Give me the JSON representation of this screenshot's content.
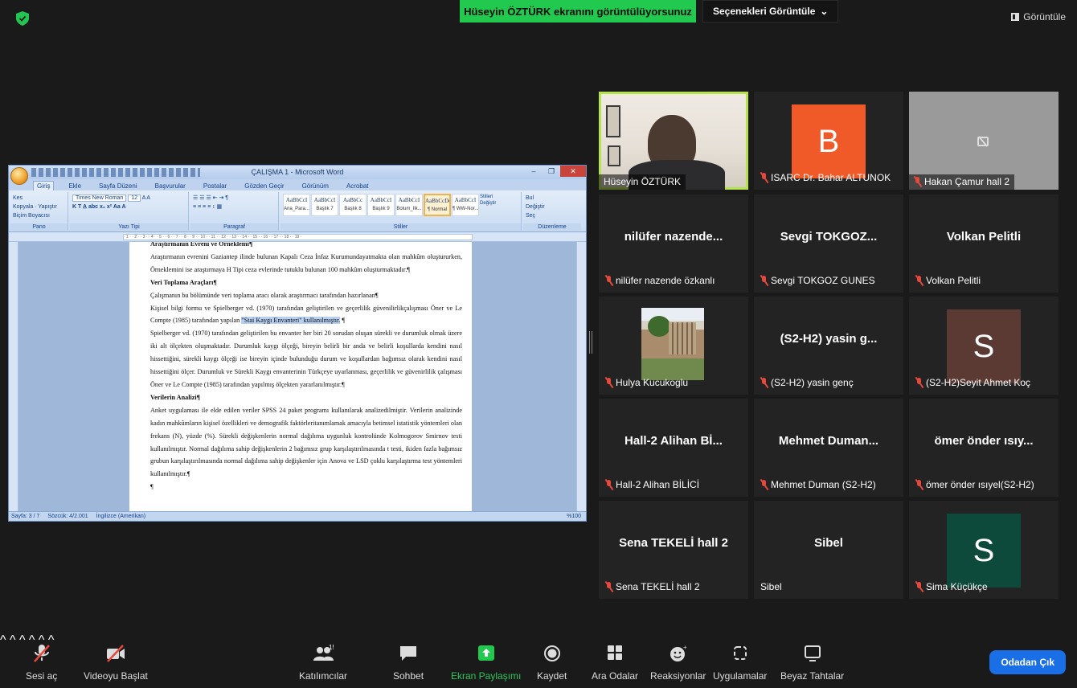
{
  "top": {
    "banner": "Hüseyin  ÖZTÜRK ekranını görüntülüyorsunuz",
    "view_options": "Seçenekleri Görüntüle",
    "view_button": "Görüntüle"
  },
  "word": {
    "title": "ÇALIŞMA 1 - Microsoft Word",
    "tabs": [
      "Giriş",
      "Ekle",
      "Sayfa Düzeni",
      "Başvurular",
      "Postalar",
      "Gözden Geçir",
      "Görünüm",
      "Acrobat"
    ],
    "ribbon": {
      "clipboard": {
        "label": "Pano",
        "cut": "Kes",
        "copy": "Kopyala",
        "paste": "Yapıştır",
        "format_painter": "Biçim Boyacısı"
      },
      "font": {
        "label": "Yazı Tipi",
        "name": "Times New Roman",
        "size": "12"
      },
      "paragraph": {
        "label": "Paragraf"
      },
      "styles": {
        "label": "Stiller",
        "items": [
          {
            "preview": "AaBbCcI",
            "name": "Ana_Para..."
          },
          {
            "preview": "AaBbCcI",
            "name": "Başlık 7"
          },
          {
            "preview": "AaBbCc",
            "name": "Başlık 8"
          },
          {
            "preview": "AaBbCcI",
            "name": "Başlık 9"
          },
          {
            "preview": "AaBbCcI",
            "name": "Bolum_Ilk..."
          },
          {
            "preview": "AaBbCcDc",
            "name": "¶ Normal"
          },
          {
            "preview": "AaBbCcI",
            "name": "¶ WW-Nor..."
          }
        ],
        "change": "Stilleri Değiştir"
      },
      "editing": {
        "label": "Düzenleme",
        "find": "Bul",
        "replace": "Değiştir",
        "select": "Seç"
      }
    },
    "doc": {
      "h0": "Araştırmanın Evreni ve Örneklemi¶",
      "p1": "Araştırmanın evrenini Gaziantep ilinde bulunan Kapalı Ceza İnfaz Kurumundayatmakta olan mahkûm oluştururken, Örneklemini ise araştırmaya H Tipi ceza evlerinde tutuklu bulunan 100 mahkûm oluşturmaktadır.¶",
      "h1": "Veri Toplama Araçları¶",
      "p2": "Çalışmanın bu bölümünde veri toplama aracı olarak araştırmacı tarafından hazırlanan¶",
      "p3a": "Kişisel bilgi formu ve Spielberger vd. (1970) tarafından geliştirilen ve geçerlilik güvenilirlikçalışması Öner ve Le Compte (1985) tarafından yapılan ",
      "p3b": "\"Stai Kaygı Envanteri\" kullanılmıştır.",
      "p3c": " ¶",
      "p4": "Spielberger vd. (1970) tarafından geliştirilen bu envanter her biri 20 sorudan oluşan sürekli ve durumluk olmak üzere iki alt ölçekten oluşmaktadır. Durumluk kaygı ölçeği, bireyin belirli bir anda ve belirli koşullarda kendini nasıl hissettiğini, sürekli kaygı ölçeği ise bireyin içinde bulunduğu durum ve koşullardan bağımsız olarak kendini nasıl hissettiğini ölçer. Durumluk ve Sürekli Kaygı envanterinin Türkçeye uyarlanması, geçerlilik ve güvenirlilik çalışması Öner ve Le Compte (1985) tarafından yapılmış ölçekten yararlanılmıştır.¶",
      "h2": "Verilerin Analizi¶",
      "p5": "Anket uygulaması ile elde edilen veriler SPSS 24 paket programı kullanılarak analizedilmiştir. Verilerin analizinde kadın mahkûmların kişisel özellikleri ve demografik faktörleritanımlamak amacıyla betimsel istatistik yöntemleri olan frekans (N), yüzde (%). Sürekli değişkenlerin normal dağılıma uygunluk kontrolünde Kolmogorov Smirnov testi kullanılmıştır. Normal dağılıma sahip değişkenlerin 2 bağımsız grup karşılaştırılmasında t testi, ikiden fazla bağımsız grubun karşılaştırılmasında normal dağılıma sahip değişkenler için Anova ve LSD çoklu karşılaştırma test yöntemleri kullanılmıştır.¶",
      "p6": "¶"
    },
    "status": {
      "page": "Sayfa: 3 / 7",
      "words": "Sözcük: 4/2.001",
      "lang": "İngilizce (Amerikan)",
      "zoom": "%100"
    }
  },
  "participants": [
    {
      "name": "Hüseyin  ÖZTÜRK",
      "kind": "video"
    },
    {
      "name": "ISARC Dr. Bahar ALTUNOK",
      "kind": "avatar",
      "initial": "B",
      "color": "#f05a28"
    },
    {
      "name": "Hakan Çamur hall 2",
      "kind": "camoff"
    },
    {
      "name": "nilüfer nazende özkanlı",
      "display": "nilüfer  nazende...",
      "kind": "text"
    },
    {
      "name": "Sevgi TOKGOZ GUNES",
      "display": "Sevgi  TOKGOZ...",
      "kind": "text"
    },
    {
      "name": "Volkan Pelitli",
      "display": "Volkan Pelitli",
      "kind": "text"
    },
    {
      "name": "Hulya Kucukoglu",
      "kind": "photo"
    },
    {
      "name": "(S2-H2) yasin genç",
      "display": "(S2-H2) yasin g...",
      "kind": "text"
    },
    {
      "name": "(S2-H2)Seyit Ahmet Koç",
      "kind": "avatar",
      "initial": "S",
      "color": "#5a3a33"
    },
    {
      "name": "Hall-2 Alihan BİLİCİ",
      "display": "Hall-2 Alihan Bİ...",
      "kind": "text"
    },
    {
      "name": "Mehmet Duman (S2-H2)",
      "display": "Mehmet  Duman...",
      "kind": "text"
    },
    {
      "name": "ömer önder ısıyel(S2-H2)",
      "display": "ömer önder ısıy...",
      "kind": "text"
    },
    {
      "name": "Sena TEKELİ hall 2",
      "display": "Sena TEKELİ hall 2",
      "kind": "text"
    },
    {
      "name": "Sibel",
      "display": "Sibel",
      "kind": "text"
    },
    {
      "name": "Sima Küçükçe",
      "kind": "avatar",
      "initial": "S",
      "color": "#0e4a3c"
    }
  ],
  "toolbar": {
    "audio": "Sesi aç",
    "video": "Videoyu Başlat",
    "participants": "Katılımcılar",
    "participants_count": "15",
    "chat": "Sohbet",
    "share": "Ekran Paylaşımı",
    "record": "Kaydet",
    "breakout": "Ara Odalar",
    "reactions": "Reaksiyonlar",
    "apps": "Uygulamalar",
    "whiteboard": "Beyaz Tahtalar",
    "leave": "Odadan Çık"
  },
  "colors": {
    "banner": "#21c94f",
    "active_speaker": "#b4e34c",
    "leave": "#1b6fe6",
    "muted": "#e5483c"
  }
}
